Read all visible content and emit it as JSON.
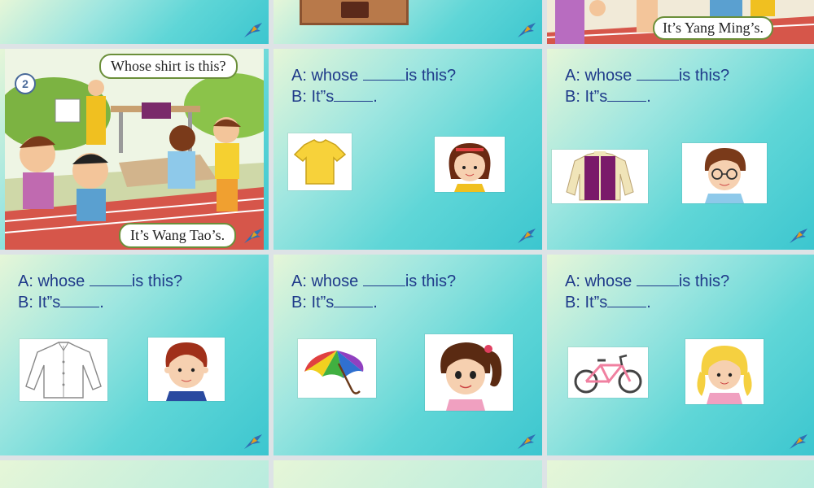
{
  "slides": {
    "top_right_caption": "It’s Yang Ming’s.",
    "story": {
      "number": "2",
      "question": "Whose shirt is this?",
      "answer": "It’s Wang Tao’s."
    },
    "exercises": [
      {
        "id": "shirt-yellow",
        "q_prefix": "A: whose ",
        "q_suffix": "is this?",
        "a_prefix": "B: It”s",
        "a_suffix": ".",
        "item_icon": "yellow-tshirt-icon",
        "person_icon": "girl-short-hair-icon"
      },
      {
        "id": "jacket",
        "q_prefix": "A: whose ",
        "q_suffix": "is this?",
        "a_prefix": "B: It”s",
        "a_suffix": ".",
        "item_icon": "purple-jacket-icon",
        "person_icon": "boy-glasses-icon"
      },
      {
        "id": "shirt-white",
        "q_prefix": "A: whose ",
        "q_suffix": "is this?",
        "a_prefix": "B: It”s",
        "a_suffix": ".",
        "item_icon": "white-shirt-icon",
        "person_icon": "boy-red-hair-icon"
      },
      {
        "id": "umbrella",
        "q_prefix": "A: whose ",
        "q_suffix": "is this?",
        "a_prefix": "B: It”s",
        "a_suffix": ".",
        "item_icon": "rainbow-umbrella-icon",
        "person_icon": "girl-ponytail-icon"
      },
      {
        "id": "bike",
        "q_prefix": "A: whose ",
        "q_suffix": "is this?",
        "a_prefix": "B: It”s",
        "a_suffix": ".",
        "item_icon": "pink-bike-icon",
        "person_icon": "girl-blonde-braids-icon"
      }
    ]
  }
}
